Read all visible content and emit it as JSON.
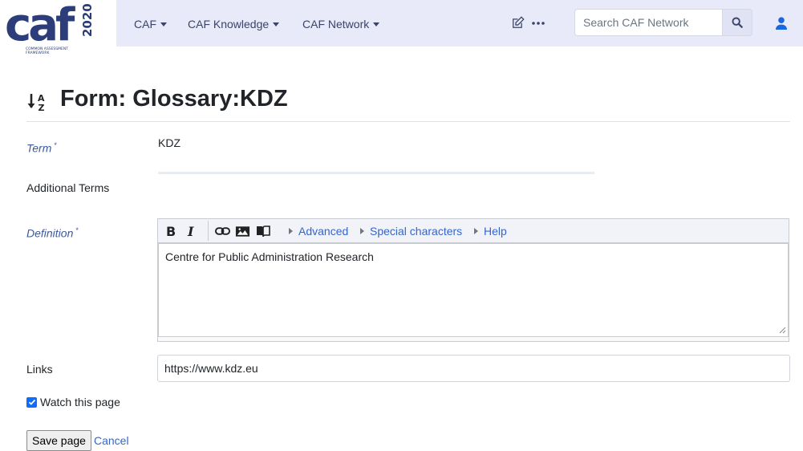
{
  "logo": {
    "main_text": "caf",
    "year": "2020",
    "tagline_1": "COMMON ASSESSMENT",
    "tagline_2": "FRAMEWORK"
  },
  "nav": {
    "items": [
      {
        "label": "CAF"
      },
      {
        "label": "CAF Knowledge"
      },
      {
        "label": "CAF Network"
      }
    ],
    "edit_icon": "edit-icon",
    "more_icon": "more-icon",
    "search_placeholder": "Search CAF Network",
    "search_icon": "search-icon",
    "user_icon": "user-icon"
  },
  "page": {
    "title": "Form: Glossary:KDZ",
    "title_icon": "sort-alpha-down-icon"
  },
  "form": {
    "term_label": "Term",
    "term_required": "*",
    "term_value": "KDZ",
    "additional_terms_label": "Additional Terms",
    "definition_label": "Definition",
    "definition_required": "*",
    "definition_value": "Centre for Public Administration Research",
    "links_label": "Links",
    "links_value": "https://www.kdz.eu",
    "watch_label": "Watch this page",
    "watch_checked": true,
    "save_label": "Save page",
    "cancel_label": "Cancel"
  },
  "editor": {
    "bold": "B",
    "italic": "I",
    "link_icon": "link-icon",
    "image_icon": "image-icon",
    "reference_icon": "book-icon",
    "groups": [
      {
        "label": "Advanced"
      },
      {
        "label": "Special characters"
      },
      {
        "label": "Help"
      }
    ]
  },
  "colors": {
    "navbar_bg": "#e8eaf9",
    "accent": "#0d6efd",
    "link": "#3366cc",
    "required_label": "#3d5a9c"
  }
}
